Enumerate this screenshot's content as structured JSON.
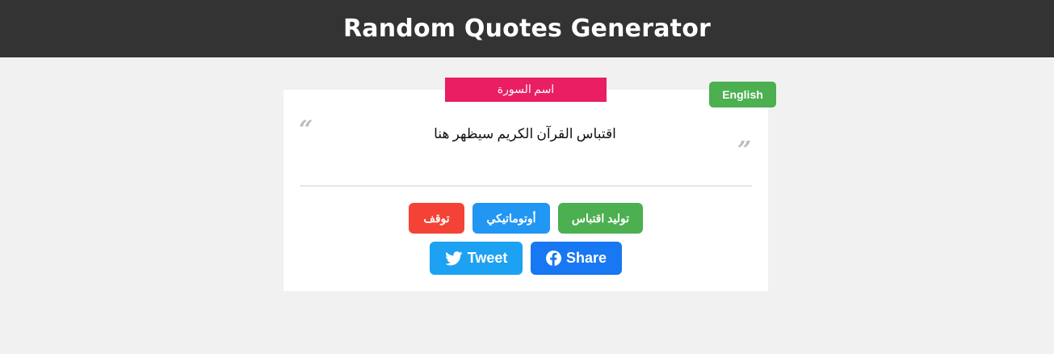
{
  "header": {
    "title": "Random Quotes Generator"
  },
  "quote_box": {
    "surah_name": "اسم السورة",
    "language_button": "English",
    "quote_text": "اقتباس القرآن الكريم سيظهر هنا",
    "open_mark": "“",
    "close_mark": "”"
  },
  "controls": {
    "stop_label": "توقف",
    "auto_label": "أوتوماتيكي",
    "generate_label": "توليد اقتباس",
    "tweet_label": "Tweet",
    "share_label": "Share"
  },
  "icons": {
    "tweet": "twitter-bird-icon",
    "share": "facebook-icon"
  },
  "colors": {
    "header_bg": "#333333",
    "surah_tag": "#e91e63",
    "english_button": "#4caf50",
    "stop_button": "#f44336",
    "auto_button": "#2196f3",
    "generate_button": "#4caf50",
    "tweet_button": "#1da1f2",
    "share_button": "#1877f2"
  }
}
